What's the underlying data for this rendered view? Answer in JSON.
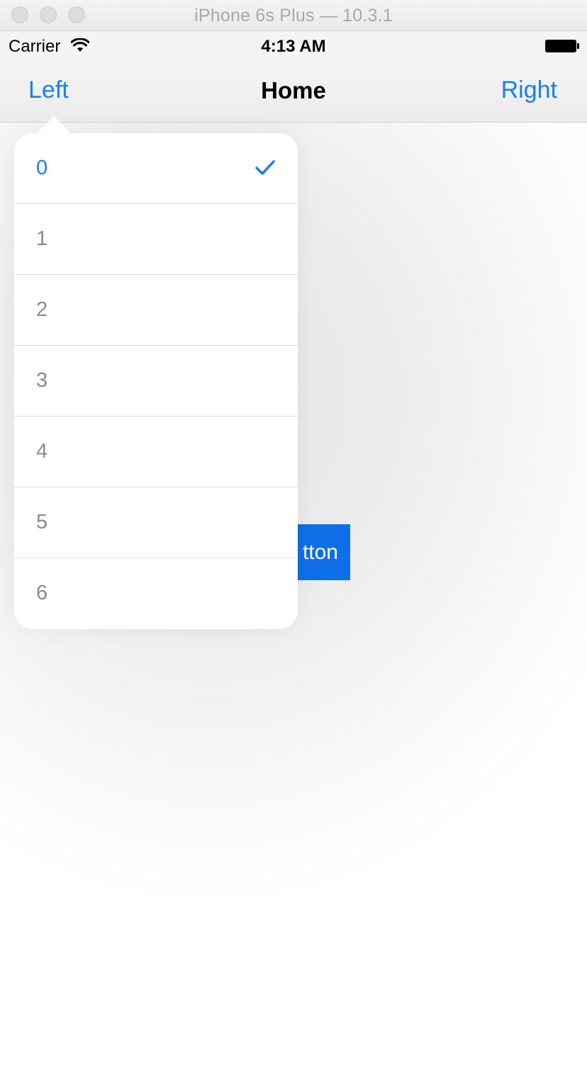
{
  "window": {
    "title": "iPhone 6s Plus — 10.3.1"
  },
  "status_bar": {
    "carrier": "Carrier",
    "time": "4:13 AM",
    "icons": [
      "wifi-icon",
      "battery-icon"
    ]
  },
  "nav_bar": {
    "left_label": "Left",
    "title": "Home",
    "right_label": "Right"
  },
  "content": {
    "button_visible_text": "tton"
  },
  "popover_menu": {
    "selected_index": 0,
    "items": [
      {
        "label": "0",
        "selected": true
      },
      {
        "label": "1",
        "selected": false
      },
      {
        "label": "2",
        "selected": false
      },
      {
        "label": "3",
        "selected": false
      },
      {
        "label": "4",
        "selected": false
      },
      {
        "label": "5",
        "selected": false
      },
      {
        "label": "6",
        "selected": false
      }
    ]
  },
  "colors": {
    "accent": "#1a7ef0",
    "button_bg": "#0f6fe8",
    "item_text": "#8a8a8a"
  }
}
